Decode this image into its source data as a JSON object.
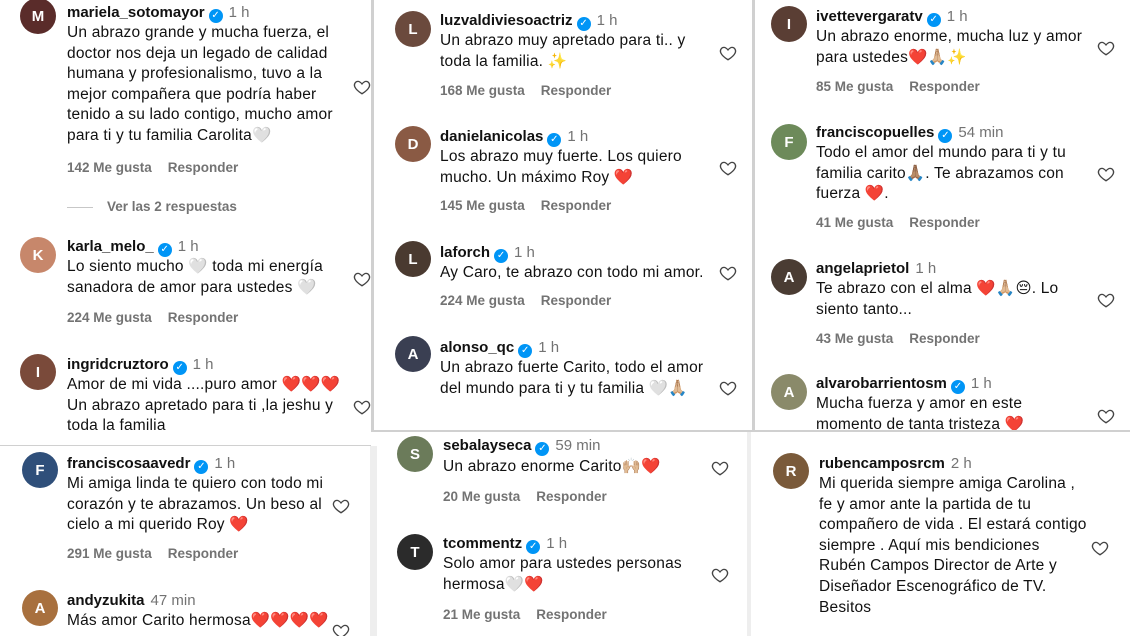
{
  "panels": [
    {
      "comments": [
        {
          "user": "mariela_sotomayor",
          "time": "1 h",
          "text": "Un abrazo grande y mucha fuerza, el doctor nos deja un legado de calidad humana y profesionalismo, tuvo a la mejor compañera que podría haber tenido a su lado contigo, mucho amor para ti y tu familia Carolita🤍",
          "likes": "142 Me gusta",
          "reply": "Responder",
          "more": "Ver las 2 respuestas"
        },
        {
          "user": "karla_melo_",
          "time": "1 h",
          "text": "Lo siento mucho 🤍 toda mi energía sanadora de amor para ustedes 🤍",
          "likes": "224 Me gusta",
          "reply": "Responder"
        },
        {
          "user": "ingridcruztoro",
          "time": "1 h",
          "text": "Amor de mi vida ....puro amor ❤️❤️❤️ Un abrazo apretado para ti ,la jeshu y toda la familia"
        }
      ]
    },
    {
      "comments": [
        {
          "user": "luzvaldiviesoactriz",
          "time": "1 h",
          "text": "Un abrazo muy apretado para ti.. y toda la familia. ✨",
          "likes": "168 Me gusta",
          "reply": "Responder"
        },
        {
          "user": "danielanicolas",
          "time": "1 h",
          "text": "Los abrazo muy fuerte. Los quiero mucho. Un máximo Roy ❤️",
          "likes": "145 Me gusta",
          "reply": "Responder"
        },
        {
          "user": "laforch",
          "time": "1 h",
          "text": "Ay Caro, te abrazo con todo mi amor.",
          "likes": "224 Me gusta",
          "reply": "Responder"
        },
        {
          "user": "alonso_qc",
          "time": "1 h",
          "text": "Un abrazo fuerte Carito, todo el amor del mundo para ti y tu familia 🤍🙏🏼"
        }
      ]
    },
    {
      "comments": [
        {
          "user": "ivettevergaratv",
          "time": "1 h",
          "text": "Un abrazo enorme, mucha luz y amor para ustedes❤️🙏🏼✨",
          "likes": "85 Me gusta",
          "reply": "Responder"
        },
        {
          "user": "franciscopuelles",
          "time": "54 min",
          "text": "Todo el amor del mundo para ti y tu familia carito🙏🏽. Te abrazamos con fuerza ❤️.",
          "likes": "41 Me gusta",
          "reply": "Responder"
        },
        {
          "user": "angelaprietol",
          "time": "1 h",
          "text": "Te abrazo con el alma ❤️🙏🏼😔. Lo siento tanto...",
          "likes": "43 Me gusta",
          "reply": "Responder"
        },
        {
          "user": "alvarobarrientosm",
          "time": "1 h",
          "text": "Mucha fuerza y amor en este momento de tanta tristeza ❤️"
        }
      ]
    },
    {
      "comments": [
        {
          "user": "franciscosaavedr",
          "time": "1 h",
          "text": "Mi amiga linda te quiero con todo mi corazón y te abrazamos. Un beso al cielo a mi querido Roy ❤️",
          "likes": "291 Me gusta",
          "reply": "Responder"
        },
        {
          "user": "andyzukita",
          "time": "47 min",
          "text": "Más amor Carito hermosa❤️❤️❤️❤️"
        }
      ]
    },
    {
      "comments": [
        {
          "user": "sebalayseca",
          "time": "59 min",
          "text": "Un abrazo enorme Carito🙌🏼❤️",
          "likes": "20 Me gusta",
          "reply": "Responder"
        },
        {
          "user": "tcommentz",
          "time": "1 h",
          "text": "Solo amor para ustedes personas hermosa🤍❤️",
          "likes": "21 Me gusta",
          "reply": "Responder"
        }
      ]
    },
    {
      "comments": [
        {
          "user": "rubencamposrcm",
          "time": "2 h",
          "text": "Mi querida siempre amiga Carolina , fe y amor ante la partida de tu compañero de vida . El estará contigo siempre . Aquí mis bendiciones Rubén Campos Director de Arte y Diseñador Escenográfico de TV. Besitos"
        }
      ]
    }
  ],
  "icons": {
    "verified": "verified-badge-icon",
    "like": "heart-outline-icon"
  },
  "colors": {
    "verified": "#0095f6",
    "muted": "#737373",
    "text": "#111111"
  }
}
